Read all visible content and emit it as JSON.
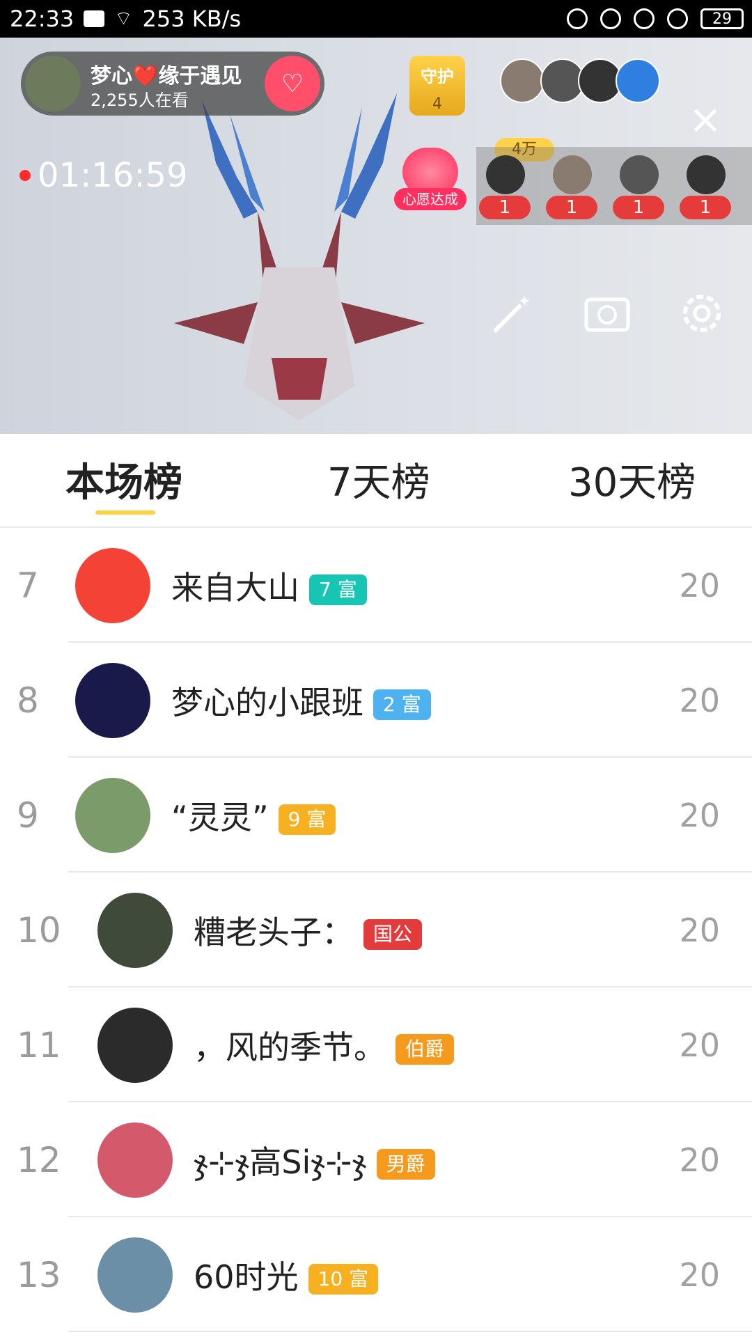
{
  "status_bar": {
    "time": "22:33",
    "network_speed": "253 KB/s",
    "battery": "29"
  },
  "room": {
    "host_name": "梦心❤️缘于遇见",
    "viewers": "2,255人在看",
    "guard_label": "守护",
    "guard_count": "4",
    "top_score": "4万",
    "timer": "01:16:59",
    "wish_label": "心愿达成",
    "strip_counts": [
      "1",
      "1",
      "1",
      "1"
    ]
  },
  "tabs": [
    "本场榜",
    "7天榜",
    "30天榜"
  ],
  "rows": [
    {
      "rank": "7",
      "name": "来自大山",
      "badge": "7 富",
      "badge_color": "#16c6b2",
      "score": "20",
      "avatar_color": "#f44336"
    },
    {
      "rank": "8",
      "name": "梦心的小跟班",
      "badge": "2 富",
      "badge_color": "#4db2ef",
      "score": "20",
      "avatar_color": "#1a1a4a"
    },
    {
      "rank": "9",
      "name": "“灵灵”",
      "badge": "9 富",
      "badge_color": "#f7b020",
      "score": "20",
      "avatar_color": "#7b9b6a"
    },
    {
      "rank": "10",
      "name": "糟老头子：",
      "badge": "国公",
      "badge_color": "#e33b3b",
      "score": "20",
      "avatar_color": "#3f4a3a"
    },
    {
      "rank": "11",
      "name": "，风的季节。",
      "badge": "伯爵",
      "badge_color": "#f59a1d",
      "score": "20",
      "avatar_color": "#2b2b2b"
    },
    {
      "rank": "12",
      "name": "ჯ⊹ჯ高Siჯ⊹ჯ",
      "badge": "男爵",
      "badge_color": "#f59a1d",
      "score": "20",
      "avatar_color": "#d45a6b"
    },
    {
      "rank": "13",
      "name": "60时光",
      "badge": "10 富",
      "badge_color": "#f7b020",
      "score": "20",
      "avatar_color": "#6c8fa8"
    }
  ]
}
